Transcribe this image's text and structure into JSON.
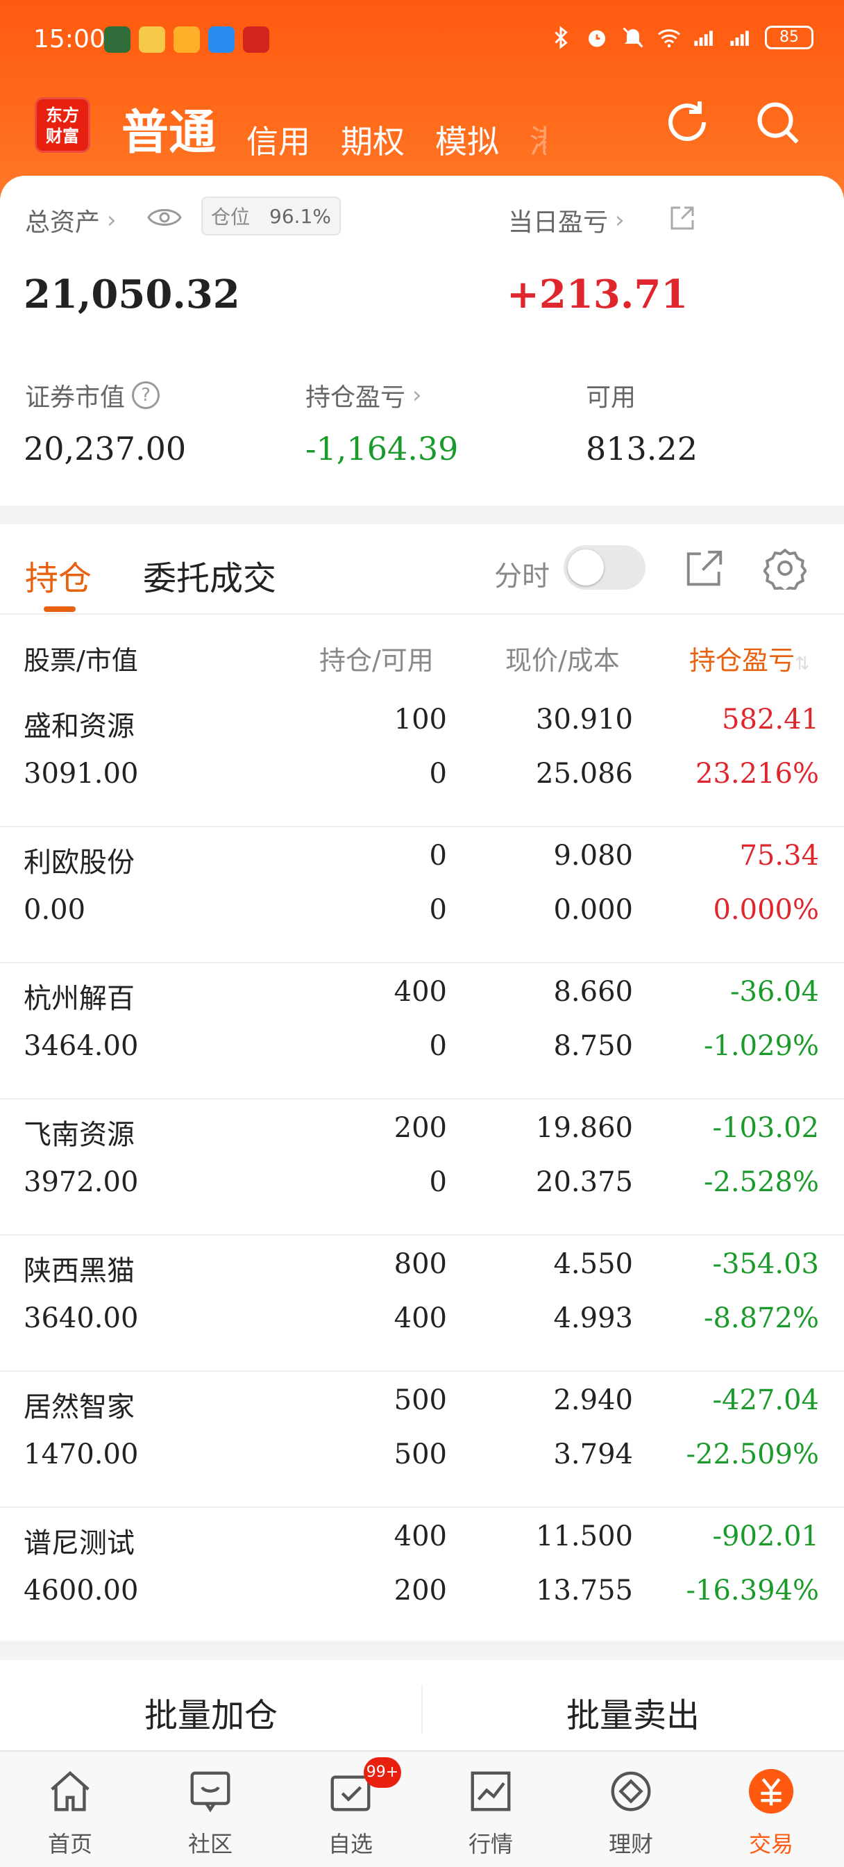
{
  "status": {
    "time": "15:00",
    "battery": "85"
  },
  "header": {
    "logo": "东方\n财富",
    "tabs": [
      {
        "label": "普通",
        "active": true
      },
      {
        "label": "信用"
      },
      {
        "label": "期权"
      },
      {
        "label": "模拟"
      },
      {
        "label": "港"
      }
    ]
  },
  "assets": {
    "total_label": "总资产",
    "total_value": "21,050.32",
    "position_label": "仓位",
    "position_value": "96.1%",
    "daily_label": "当日盈亏",
    "daily_value": "+213.71",
    "market_label": "证券市值",
    "market_value": "20,237.00",
    "holding_label": "持仓盈亏",
    "holding_value": "-1,164.39",
    "available_label": "可用",
    "available_value": "813.22"
  },
  "positions": {
    "tab_holdings": "持仓",
    "tab_orders": "委托成交",
    "fenshi": "分时",
    "columns": [
      "股票/市值",
      "持仓/可用",
      "现价/成本",
      "持仓盈亏"
    ],
    "rows": [
      {
        "name": "盛和资源",
        "value": "3091.00",
        "hold": "100",
        "avail": "0",
        "price": "30.910",
        "cost": "25.086",
        "pl": "582.41",
        "plpct": "23.216%",
        "dir": "up"
      },
      {
        "name": "利欧股份",
        "value": "0.00",
        "hold": "0",
        "avail": "0",
        "price": "9.080",
        "cost": "0.000",
        "pl": "75.34",
        "plpct": "0.000%",
        "dir": "up"
      },
      {
        "name": "杭州解百",
        "value": "3464.00",
        "hold": "400",
        "avail": "0",
        "price": "8.660",
        "cost": "8.750",
        "pl": "-36.04",
        "plpct": "-1.029%",
        "dir": "down"
      },
      {
        "name": "飞南资源",
        "value": "3972.00",
        "hold": "200",
        "avail": "0",
        "price": "19.860",
        "cost": "20.375",
        "pl": "-103.02",
        "plpct": "-2.528%",
        "dir": "down"
      },
      {
        "name": "陕西黑猫",
        "value": "3640.00",
        "hold": "800",
        "avail": "400",
        "price": "4.550",
        "cost": "4.993",
        "pl": "-354.03",
        "plpct": "-8.872%",
        "dir": "down"
      },
      {
        "name": "居然智家",
        "value": "1470.00",
        "hold": "500",
        "avail": "500",
        "price": "2.940",
        "cost": "3.794",
        "pl": "-427.04",
        "plpct": "-22.509%",
        "dir": "down"
      },
      {
        "name": "谱尼测试",
        "value": "4600.00",
        "hold": "400",
        "avail": "200",
        "price": "11.500",
        "cost": "13.755",
        "pl": "-902.01",
        "plpct": "-16.394%",
        "dir": "down"
      }
    ]
  },
  "batch": {
    "add": "批量加仓",
    "sell": "批量卖出"
  },
  "nav": [
    {
      "label": "首页",
      "icon": "home-icon"
    },
    {
      "label": "社区",
      "icon": "community-icon"
    },
    {
      "label": "自选",
      "icon": "watchlist-icon",
      "badge": "99+"
    },
    {
      "label": "行情",
      "icon": "market-icon"
    },
    {
      "label": "理财",
      "icon": "finance-icon"
    },
    {
      "label": "交易",
      "icon": "trade-icon",
      "active": true
    }
  ],
  "colors": {
    "brand": "#ff5a10",
    "up": "#e0262d",
    "down": "#1a9a2a"
  }
}
